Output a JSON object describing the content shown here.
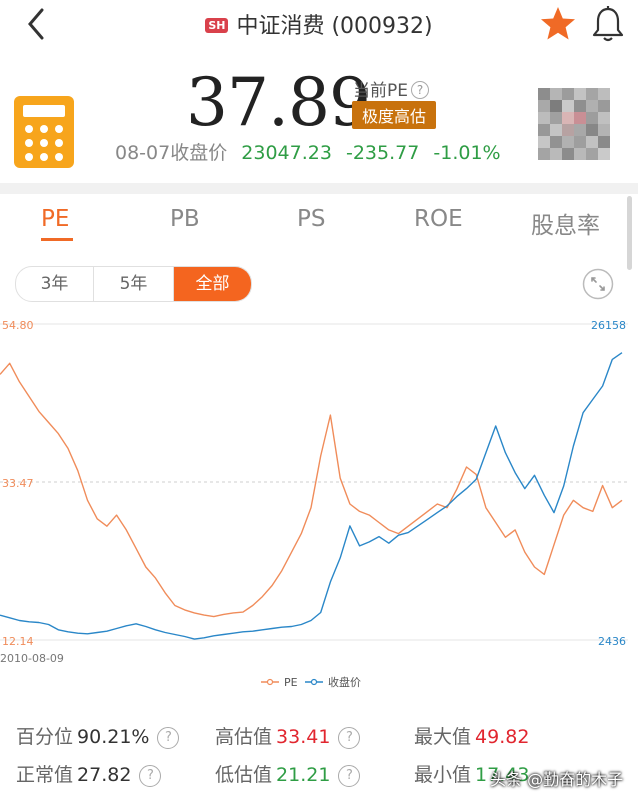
{
  "header": {
    "market_badge": "SH",
    "title": "中证消费 (000932)",
    "colors": {
      "star": "#f06a26",
      "badge": "#d9414b"
    }
  },
  "quote": {
    "pe_value": "37.89",
    "pe_label": "当前PE",
    "help": "?",
    "valuation_badge": "极度高估",
    "close_label": "08-07收盘价",
    "close_price": "23047.23",
    "change": "-235.77",
    "change_pct": "-1.01%"
  },
  "tabs": [
    "PE",
    "PB",
    "PS",
    "ROE",
    "股息率"
  ],
  "active_tab": "PE",
  "range": {
    "options": [
      "3年",
      "5年",
      "全部"
    ],
    "selected": "全部"
  },
  "chart_data": {
    "type": "line",
    "x_start_label": "2010-08-09",
    "left_axis": {
      "max_label": "54.80",
      "mid_label": "33.47",
      "min_label": "12.14",
      "ylim": [
        12.14,
        54.8
      ]
    },
    "right_axis": {
      "max_label": "26158",
      "min_label": "2436"
    },
    "legend": [
      "PE",
      "收盘价"
    ],
    "series": [
      {
        "name": "PE",
        "color": "#f08c5a",
        "values": [
          48,
          49.5,
          47,
          45,
          43,
          41.5,
          40,
          38,
          35,
          31,
          28.5,
          27.5,
          29,
          27,
          24.5,
          22,
          20.5,
          18.5,
          16.8,
          16.2,
          15.8,
          15.5,
          15.3,
          15.6,
          15.8,
          15.9,
          16.8,
          18,
          19.5,
          21.5,
          24,
          26.5,
          30,
          37,
          42.5,
          34,
          30.5,
          29.5,
          29,
          28,
          27,
          26.5,
          27.5,
          28.5,
          29.5,
          30.5,
          30,
          32.5,
          35.5,
          34.5,
          30,
          28,
          26,
          27,
          24,
          22,
          21,
          25,
          29,
          31,
          30,
          29.5,
          33,
          30,
          31
        ]
      },
      {
        "name": "收盘价",
        "color": "#2a87c8",
        "values": [
          4300,
          4100,
          3900,
          3800,
          3750,
          3600,
          3200,
          3050,
          2950,
          2900,
          3000,
          3100,
          3300,
          3500,
          3650,
          3450,
          3200,
          3000,
          2850,
          2700,
          2500,
          2600,
          2750,
          2850,
          2950,
          3050,
          3100,
          3200,
          3300,
          3400,
          3450,
          3600,
          3900,
          4500,
          6800,
          8600,
          11000,
          9500,
          9800,
          10200,
          9700,
          10300,
          10500,
          11000,
          11500,
          12000,
          12500,
          13200,
          13800,
          14500,
          16500,
          18500,
          16500,
          15000,
          13800,
          14800,
          13300,
          12000,
          14000,
          17000,
          19500,
          20500,
          21500,
          23500,
          24000
        ]
      }
    ]
  },
  "stats": {
    "percentile_label": "百分位",
    "percentile": "90.21%",
    "high_label": "高估值",
    "high": "33.41",
    "max_label": "最大值",
    "max": "49.82",
    "normal_label": "正常值",
    "normal": "27.82",
    "low_label": "低估值",
    "low": "21.21",
    "min_label": "最小值",
    "min": "17.43"
  },
  "watermark": "头条 @勤奋的木子"
}
